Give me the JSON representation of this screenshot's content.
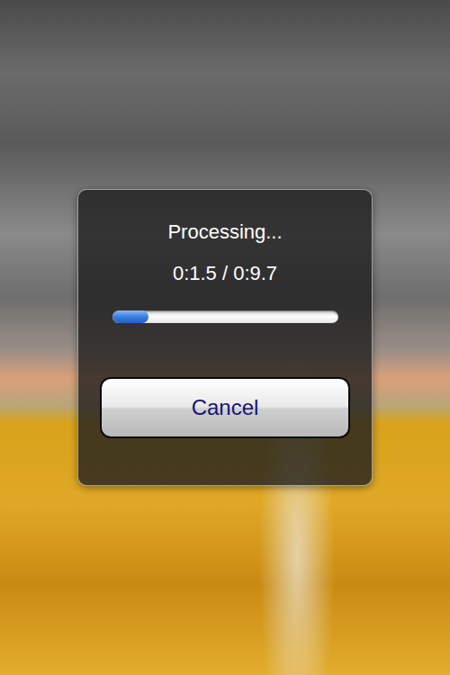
{
  "dialog": {
    "title": "Processing...",
    "time": "0:1.5 / 0:9.7",
    "progress": {
      "level": 0.16
    },
    "buttons": [
      {
        "label": "Cancel"
      }
    ]
  }
}
